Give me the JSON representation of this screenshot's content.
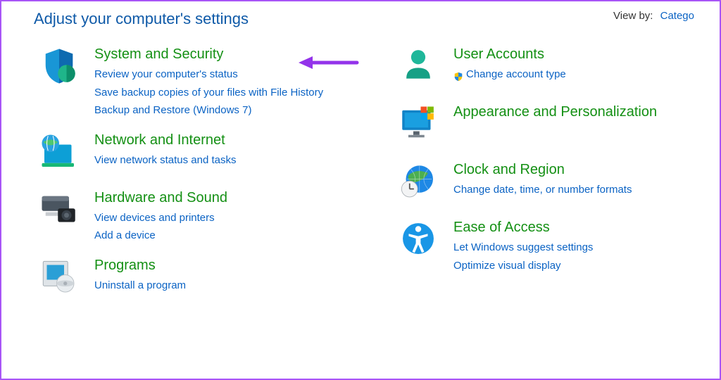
{
  "header": {
    "title": "Adjust your computer's settings",
    "viewby_label": "View by:",
    "viewby_value": "Catego"
  },
  "left": [
    {
      "title": "System and Security",
      "links": [
        "Review your computer's status",
        "Save backup copies of your files with File History",
        "Backup and Restore (Windows 7)"
      ]
    },
    {
      "title": "Network and Internet",
      "links": [
        "View network status and tasks"
      ]
    },
    {
      "title": "Hardware and Sound",
      "links": [
        "View devices and printers",
        "Add a device"
      ]
    },
    {
      "title": "Programs",
      "links": [
        "Uninstall a program"
      ]
    }
  ],
  "right": [
    {
      "title": "User Accounts",
      "links": [
        "Change account type"
      ],
      "shield": [
        true
      ]
    },
    {
      "title": "Appearance and Personalization",
      "links": []
    },
    {
      "title": "Clock and Region",
      "links": [
        "Change date, time, or number formats"
      ]
    },
    {
      "title": "Ease of Access",
      "links": [
        "Let Windows suggest settings",
        "Optimize visual display"
      ]
    }
  ],
  "colors": {
    "link": "#0b63c4",
    "heading": "#149014",
    "title": "#0f5aa8",
    "arrow": "#9333ea"
  }
}
